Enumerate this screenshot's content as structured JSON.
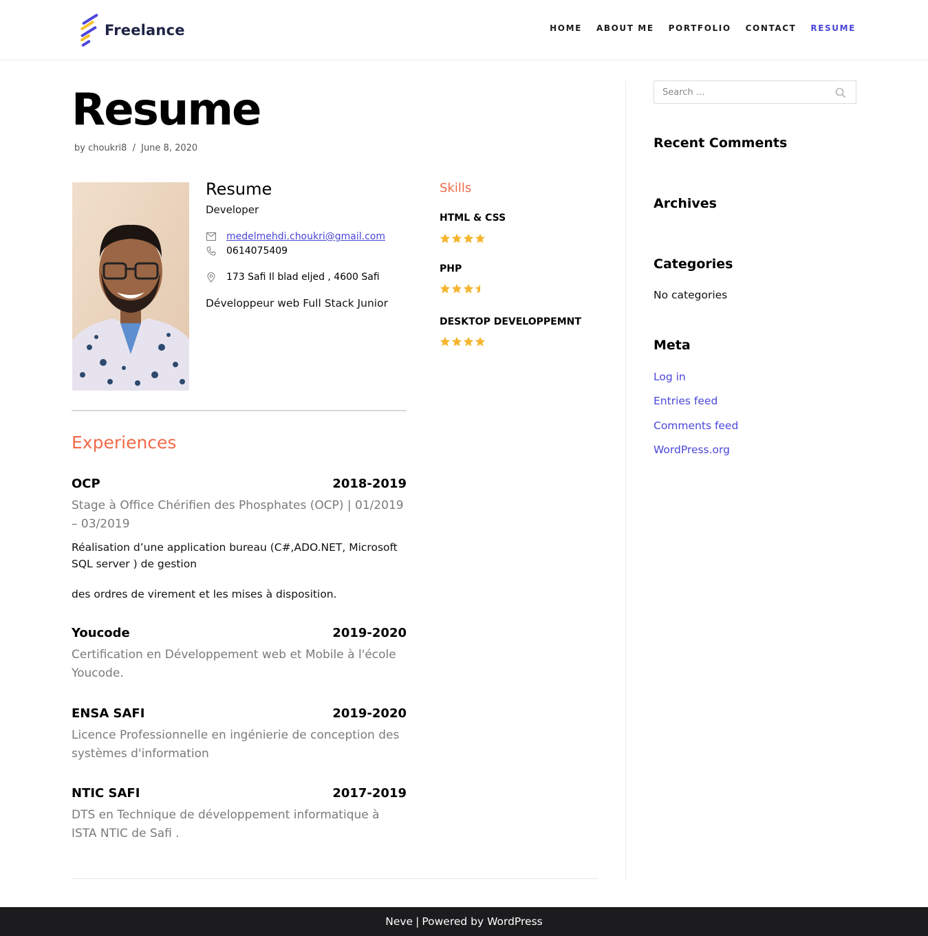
{
  "brand": {
    "name": "Freelance",
    "colors": [
      "#4a46d9",
      "#f6c12a"
    ]
  },
  "nav": {
    "items": [
      {
        "label": "HOME"
      },
      {
        "label": "ABOUT ME"
      },
      {
        "label": "PORTFOLIO"
      },
      {
        "label": "CONTACT"
      },
      {
        "label": "RESUME"
      }
    ],
    "active_index": 4
  },
  "post": {
    "title": "Resume",
    "meta": {
      "by": "by",
      "author": "choukri8",
      "separator": "/",
      "date": "June 8, 2020"
    }
  },
  "profile": {
    "photo_icon": "profile-photo",
    "name": "Resume",
    "role": "Developer",
    "email": "medelmehdi.choukri@gmail.com",
    "phone": "0614075409",
    "address": "173 Safi Il blad eljed , 4600 Safi",
    "summary": "Développeur web Full Stack Junior"
  },
  "skills": {
    "title": "Skills",
    "items": [
      {
        "name": "HTML & CSS",
        "rating": 4
      },
      {
        "name": "PHP",
        "rating": 3.5
      },
      {
        "name": "DESKTOP DEVELOPPEMNT",
        "rating": 4
      }
    ],
    "star_color": "#f5b52e"
  },
  "experiences": {
    "title": "Experiences",
    "items": [
      {
        "org": "OCP",
        "period": "2018-2019",
        "subtitle": "Stage à Office Chérifien des Phosphates (OCP) | 01/2019 – 03/2019",
        "desc": "Réalisation d’une application bureau (C#,ADO.NET, Microsoft SQL server ) de gestion",
        "desc2": "des ordres de virement et les mises à disposition."
      },
      {
        "org": "Youcode",
        "period": "2019-2020",
        "subtitle": "Certification en Développement web et Mobile à l'école Youcode."
      },
      {
        "org": "ENSA SAFI",
        "period": "2019-2020",
        "subtitle": "Licence Professionnelle en ingénierie de conception des systèmes d'information"
      },
      {
        "org": "NTIC SAFI",
        "period": "2017-2019",
        "subtitle": "DTS en Technique de développement informatique à ISTA NTIC de Safi ."
      }
    ]
  },
  "sidebar": {
    "search_placeholder": "Search …",
    "recent_comments": "Recent Comments",
    "archives": "Archives",
    "categories": {
      "title": "Categories",
      "empty": "No categories"
    },
    "meta": {
      "title": "Meta",
      "links": [
        "Log in",
        "Entries feed",
        "Comments feed",
        "WordPress.org"
      ]
    }
  },
  "footer": {
    "theme": "Neve",
    "separator": "|",
    "powered": "Powered by WordPress"
  },
  "colors": {
    "accent": "#4a46d9",
    "heading_orange": "#f06a4a",
    "footer_bg": "#1c1c1e"
  }
}
